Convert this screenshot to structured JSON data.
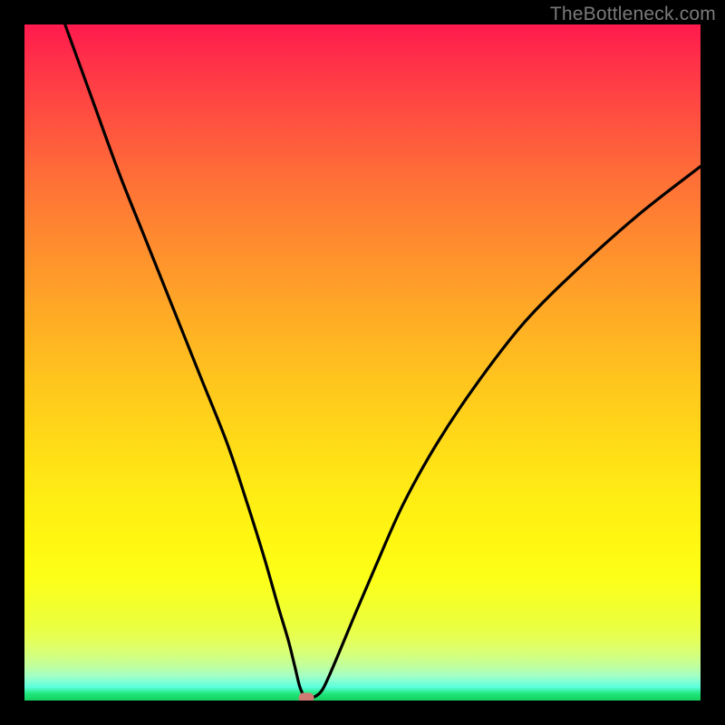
{
  "watermark": "TheBottleneck.com",
  "colors": {
    "frame": "#000000",
    "curve": "#000000",
    "marker": "#cf7b74"
  },
  "chart_data": {
    "type": "line",
    "title": "",
    "xlabel": "",
    "ylabel": "",
    "xlim": [
      0,
      100
    ],
    "ylim": [
      0,
      100
    ],
    "grid": false,
    "series": [
      {
        "name": "bottleneck-curve",
        "x": [
          6,
          10,
          14,
          18,
          22,
          26,
          30,
          33,
          35.5,
          37.5,
          39,
          40,
          40.8,
          41.7,
          43,
          44,
          45,
          46.5,
          49,
          52,
          56,
          61,
          67,
          74,
          82,
          91,
          100
        ],
        "y": [
          100,
          89,
          78,
          68,
          58,
          48,
          38,
          29,
          21,
          14,
          9,
          5,
          1.8,
          0.4,
          0.6,
          1.5,
          3.5,
          7,
          13,
          20,
          29,
          38,
          47,
          56,
          64,
          72,
          79
        ]
      }
    ],
    "marker": {
      "x": 41.7,
      "y": 0.4
    },
    "background_gradient": {
      "top": "#ff1a4d",
      "mid": "#ffed14",
      "bottom": "#15d060"
    }
  }
}
